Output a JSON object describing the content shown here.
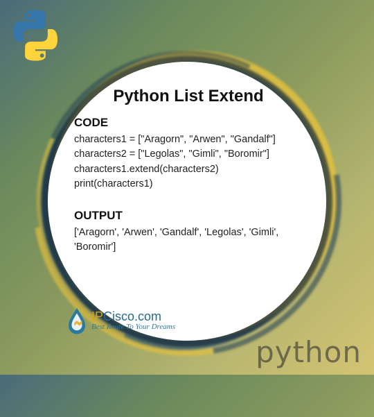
{
  "title": "Python List Extend",
  "sections": {
    "code_heading": "CODE",
    "code_lines": "characters1 = [\"Aragorn\", \"Arwen\", \"Gandalf\"]\ncharacters2 = [\"Legolas\", \"Gimli\", \"Boromir\"]\ncharacters1.extend(characters2)\nprint(characters1)",
    "output_heading": "OUTPUT",
    "output_lines": "['Aragorn', 'Arwen', 'Gandalf', 'Legolas', 'Gimli', 'Boromir']"
  },
  "brand": {
    "ipcisco_prefix": "IP",
    "ipcisco_rest": "Cisco.com",
    "ipcisco_tagline": "Best Route To Your Dreams"
  },
  "watermark": "python"
}
